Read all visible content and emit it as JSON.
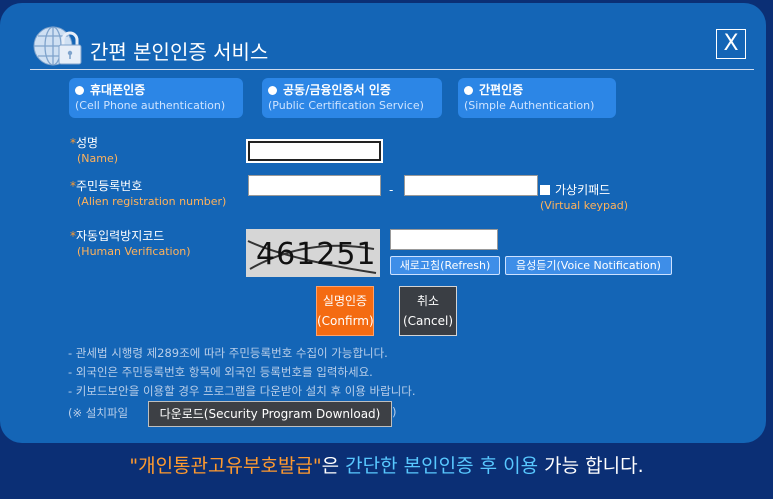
{
  "header": {
    "title": "간편 본인인증 서비스",
    "close": "X"
  },
  "options": [
    {
      "label": "휴대폰인증",
      "sub": "(Cell Phone authentication)"
    },
    {
      "label": "공동/금융인증서 인증",
      "sub": "(Public Certification Service)"
    },
    {
      "label": "간편인증",
      "sub": "(Simple Authentication)"
    }
  ],
  "form": {
    "name_label": "성명",
    "name_sub": "(Name)",
    "rrn_label": "주민등록번호",
    "rrn_sub": "(Alien registration number)",
    "dash": "-",
    "vk_label": "가상키패드",
    "vk_sub": "(Virtual keypad)",
    "hv_label": "자동입력방지코드",
    "hv_sub": "(Human Verification)",
    "captcha_text": "461251",
    "refresh": "새로고침(Refresh)",
    "voice": "음성듣기(Voice Notification)"
  },
  "buttons": {
    "confirm": "실명인증",
    "confirm_sub": "(Confirm)",
    "cancel": "취소",
    "cancel_sub": "(Cancel)"
  },
  "notes": [
    "- 관세법 시행령 제289조에 따라 주민등록번호 수집이 가능합니다.",
    "- 외국인은 주민등록번호 항목에 외국인 등록번호를 입력하세요.",
    "- 키보드보안을 이용할 경우 프로그램을 다운받아 설치 후 이용 바랍니다."
  ],
  "download": {
    "prefix": "(※ 설치파일",
    "button": "다운로드(Security Program Download)",
    "suffix": ")"
  },
  "footer": {
    "quote": "\"개인통관고유부호발급\"",
    "mid1": "은 ",
    "highlight": "간단한 본인인증 후 이용",
    "end": " 가능 합니다."
  },
  "colors": {
    "background": "#0b2f75",
    "modal": "#1465b6",
    "accent": "#f46b12",
    "option": "#2c86e6"
  }
}
